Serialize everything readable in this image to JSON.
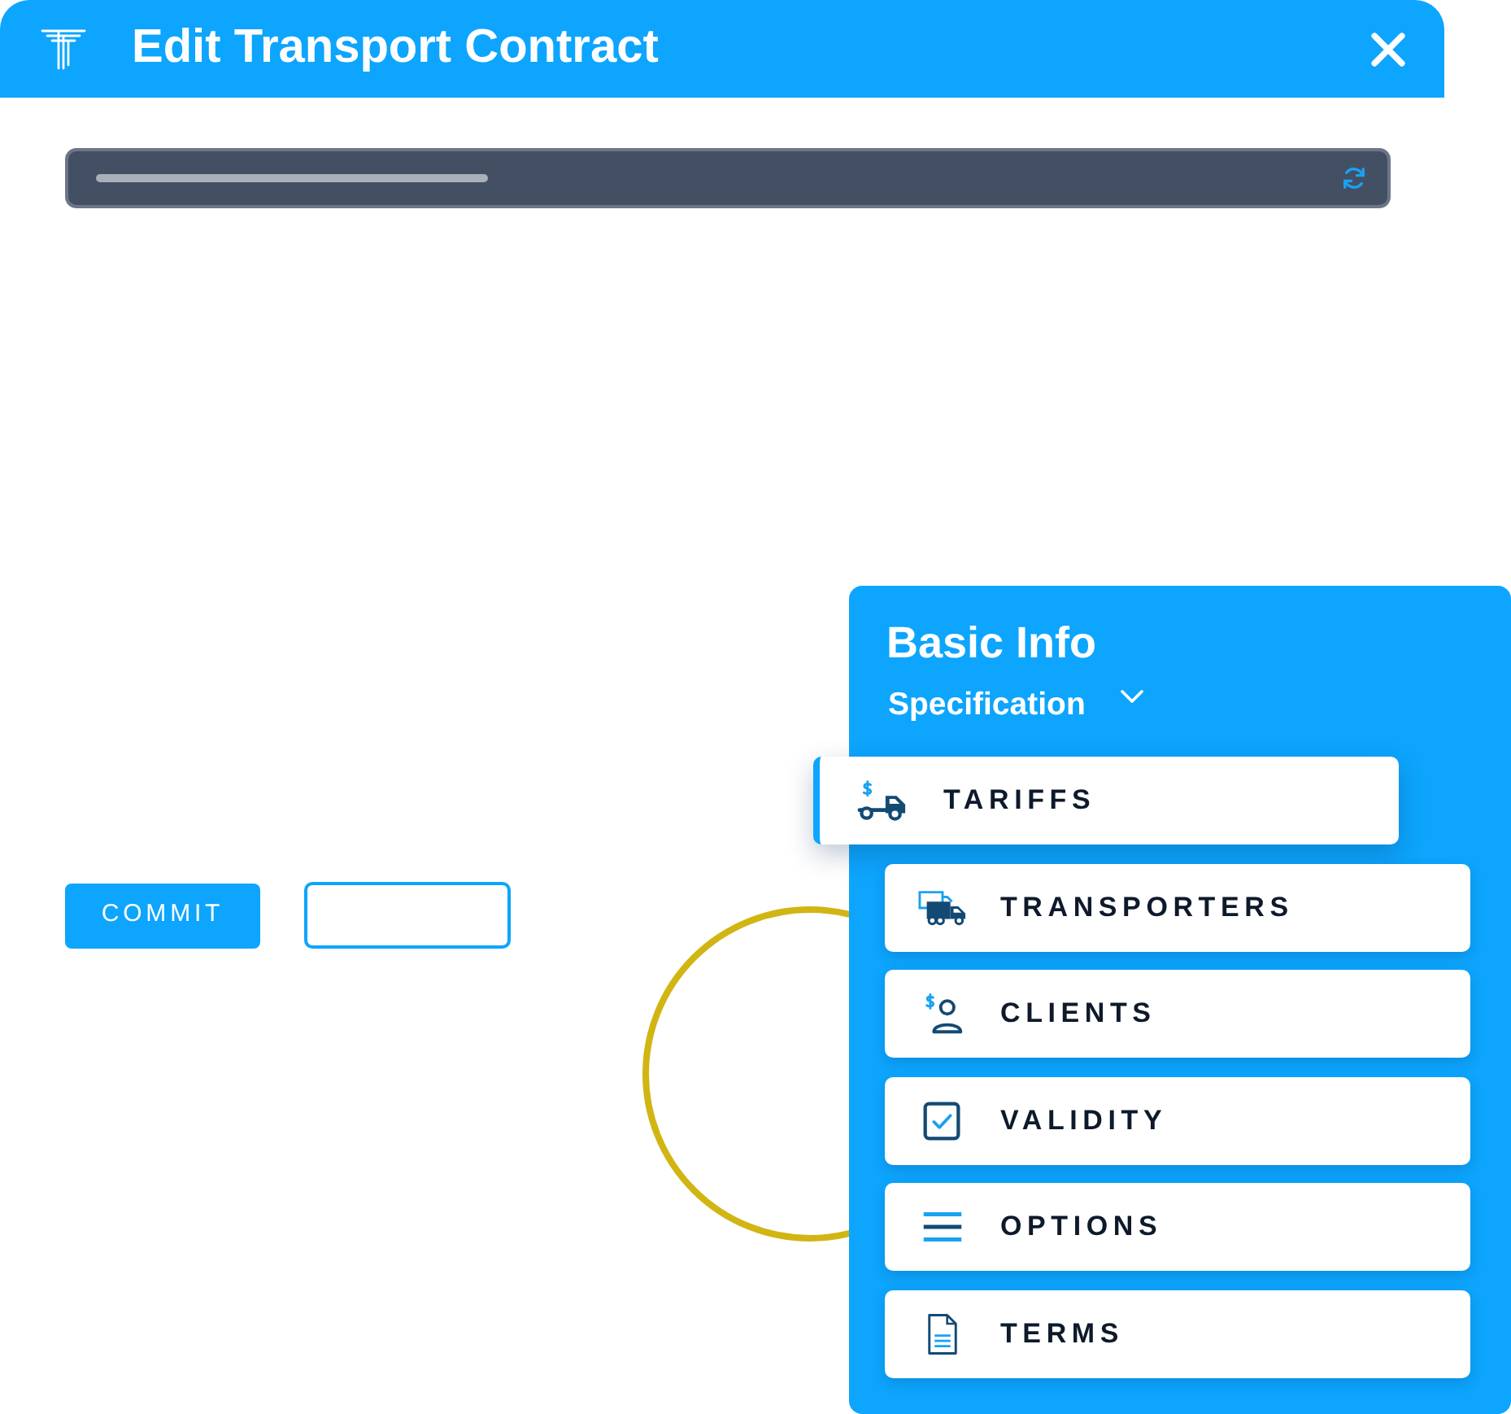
{
  "window": {
    "title": "Edit Transport Contract"
  },
  "buttons": [
    {
      "kind": "primary",
      "label": "COMMIT"
    },
    {
      "kind": "outline"
    }
  ],
  "panel": {
    "title": "Basic Info",
    "subtitle": "Specification",
    "items": [
      {
        "kind": "tariffs",
        "label": "TARIFFS",
        "selected": true
      },
      {
        "kind": "transporters",
        "label": "TRANSPORTERS",
        "selected": false
      },
      {
        "kind": "clients",
        "label": "CLIENTS",
        "selected": false
      },
      {
        "kind": "validity",
        "label": "VALIDITY",
        "selected": false
      },
      {
        "kind": "options",
        "label": "OPTIONS",
        "selected": false
      },
      {
        "kind": "terms",
        "label": "TERMS",
        "selected": false
      }
    ]
  }
}
